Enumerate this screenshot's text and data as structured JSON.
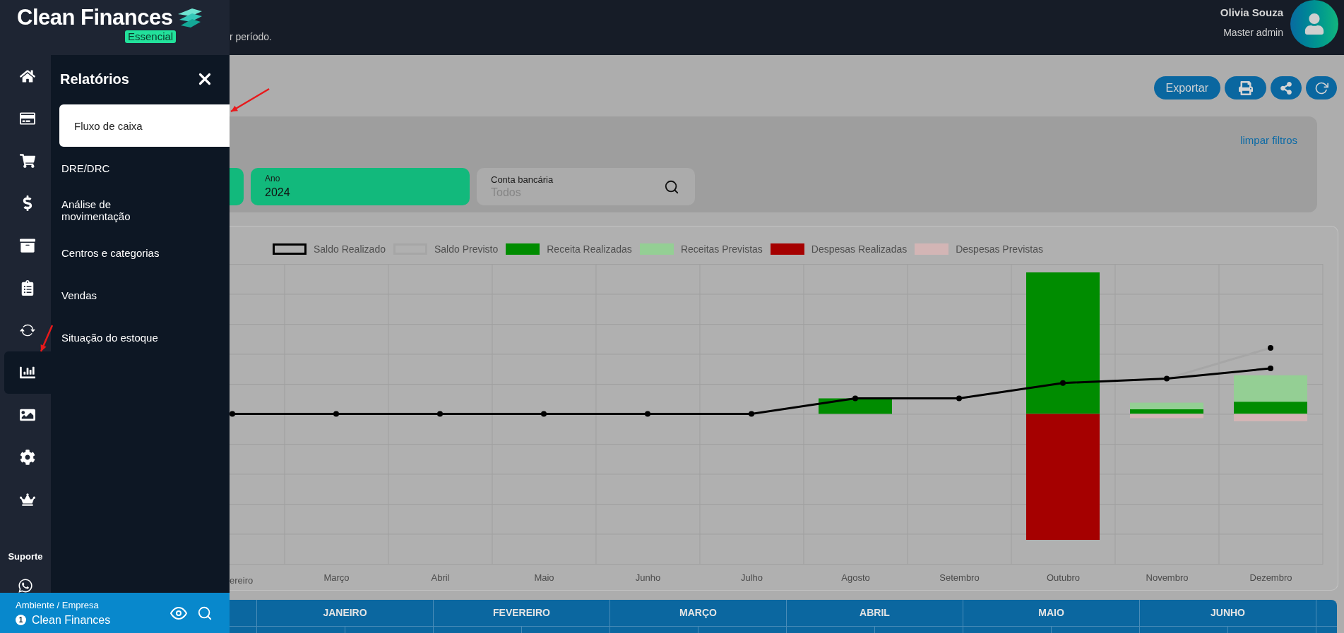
{
  "brand": {
    "name": "Clean Finances",
    "plan": "Essencial"
  },
  "header": {
    "subtitle": "r período.",
    "user": {
      "name": "Olivia Souza",
      "role": "Master admin"
    }
  },
  "sidebar": {
    "items": [
      {
        "selected": false
      },
      {
        "selected": false
      },
      {
        "selected": false
      },
      {
        "selected": false
      },
      {
        "selected": false
      },
      {
        "selected": false
      },
      {
        "selected": false
      },
      {
        "selected": true
      },
      {
        "selected": false
      },
      {
        "selected": false
      },
      {
        "selected": false
      }
    ],
    "support_label": "Suporte"
  },
  "menu": {
    "title": "Relatórios",
    "items": [
      {
        "label": "Fluxo de caixa",
        "selected": true
      },
      {
        "label": "DRE/DRC",
        "selected": false
      },
      {
        "label": "Análise de movimentação",
        "selected": false
      },
      {
        "label": "Centros e categorias",
        "selected": false
      },
      {
        "label": "Vendas",
        "selected": false
      },
      {
        "label": "Situação do estoque",
        "selected": false
      }
    ]
  },
  "workspace": {
    "label": "Ambiente / Empresa",
    "badge": "1",
    "company": "Clean Finances"
  },
  "toolbar": {
    "export_label": "Exportar"
  },
  "filters": {
    "clear_label": "limpar filtros",
    "fields": [
      {
        "kind": "select",
        "label": "Ano",
        "value": "2024"
      },
      {
        "kind": "search",
        "label": "Conta bancária",
        "placeholder": "Todos"
      }
    ]
  },
  "chart": {
    "legend": [
      {
        "label": "Saldo Realizado",
        "kind": "line",
        "color": "#000000"
      },
      {
        "label": "Saldo Previsto",
        "kind": "line",
        "color": "#a6a6a6"
      },
      {
        "label": "Receita Realizadas",
        "kind": "bar",
        "color": "#008c00"
      },
      {
        "label": "Receitas Previstas",
        "kind": "bar",
        "color": "#94cf94"
      },
      {
        "label": "Despesas Realizadas",
        "kind": "bar",
        "color": "#a50000"
      },
      {
        "label": "Despesas Previstas",
        "kind": "bar",
        "color": "#d3b5b5"
      }
    ],
    "months": [
      "ereiro",
      "Março",
      "Abril",
      "Maio",
      "Junho",
      "Julho",
      "Agosto",
      "Setembro",
      "Outubro",
      "Novembro",
      "Dezembro"
    ]
  },
  "table": {
    "columns": [
      "JANEIRO",
      "FEVEREIRO",
      "MARÇO",
      "ABRIL",
      "MAIO",
      "JUNHO"
    ]
  }
}
